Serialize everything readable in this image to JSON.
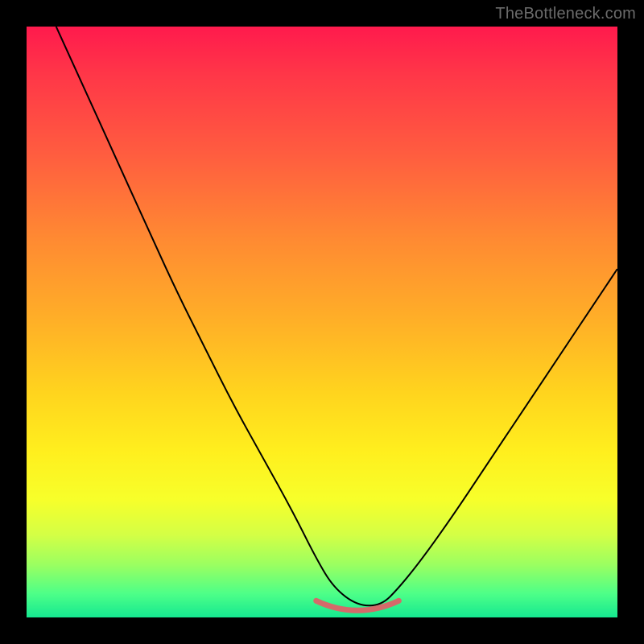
{
  "watermark": "TheBottleneck.com",
  "chart_data": {
    "type": "line",
    "title": "",
    "xlabel": "",
    "ylabel": "",
    "xlim": [
      0,
      100
    ],
    "ylim": [
      0,
      100
    ],
    "grid": false,
    "legend": false,
    "annotations": [],
    "background": "gradient-red-to-green-vertical",
    "valley_highlight": {
      "x_range": [
        49,
        63
      ],
      "y": 2,
      "color": "#d46a6a"
    },
    "series": [
      {
        "name": "bottleneck-curve",
        "x": [
          5,
          10,
          15,
          20,
          25,
          30,
          35,
          40,
          45,
          49,
          52,
          56,
          60,
          63,
          67,
          72,
          78,
          84,
          90,
          96,
          100
        ],
        "values": [
          100,
          89,
          78,
          67,
          56,
          46,
          36,
          27,
          18,
          10,
          5,
          2,
          2,
          5,
          10,
          17,
          26,
          35,
          44,
          53,
          59
        ]
      }
    ]
  }
}
